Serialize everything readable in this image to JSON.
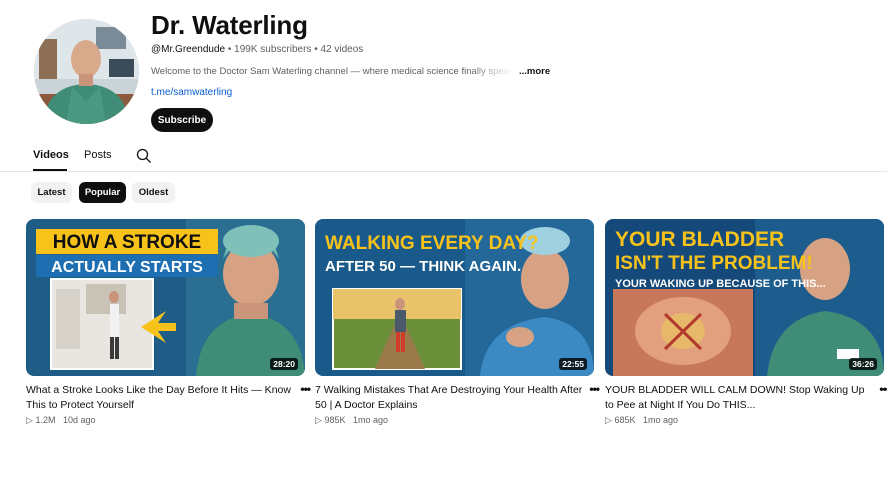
{
  "channel": {
    "name": "Dr. Waterling",
    "handle": "@Mr.Greendude",
    "subscribers": "199K subscribers",
    "videos_count": "42 videos",
    "separator": "•",
    "description": "Welcome to the Doctor Sam Waterling channel — where medical science finally speaks y",
    "more_label": "...more",
    "link": "t.me/samwaterling",
    "subscribe_label": "Subscribe"
  },
  "tabs": [
    {
      "label": "Videos",
      "active": true
    },
    {
      "label": "Posts",
      "active": false
    }
  ],
  "chips": [
    {
      "label": "Latest",
      "active": false
    },
    {
      "label": "Popular",
      "active": true
    },
    {
      "label": "Oldest",
      "active": false
    }
  ],
  "videos": [
    {
      "title": "What a Stroke Looks Like the Day Before It Hits — Know This to Protect Yourself",
      "views": "1.2M",
      "age": "10d ago",
      "duration": "28:20",
      "thumb_text_1": "HOW A STROKE",
      "thumb_text_2": "ACTUALLY STARTS"
    },
    {
      "title": "7 Walking Mistakes That Are Destroying Your Health After 50 | A Doctor Explains",
      "views": "985K",
      "age": "1mo ago",
      "duration": "22:55",
      "thumb_text_1": "WALKING EVERY DAY?",
      "thumb_text_2": "AFTER 50 — THINK AGAIN."
    },
    {
      "title": "YOUR BLADDER WILL CALM DOWN! Stop Waking Up to Pee at Night If You Do THIS...",
      "views": "685K",
      "age": "1mo ago",
      "duration": "36:26",
      "thumb_text_1": "YOUR BLADDER",
      "thumb_text_2": "ISN'T THE PROBLEM!",
      "thumb_text_3": "YOUR WAKING UP BECAUSE OF THIS..."
    }
  ],
  "icons": {
    "search": "search-icon",
    "play": "play-icon",
    "more": "more-vert-icon"
  },
  "play_glyph": "▷",
  "more_glyph": "•••",
  "colors": {
    "accent_link": "#065fd4",
    "thumb_yellow": "#f7c31b",
    "scrub_green": "#2e8b6a"
  }
}
